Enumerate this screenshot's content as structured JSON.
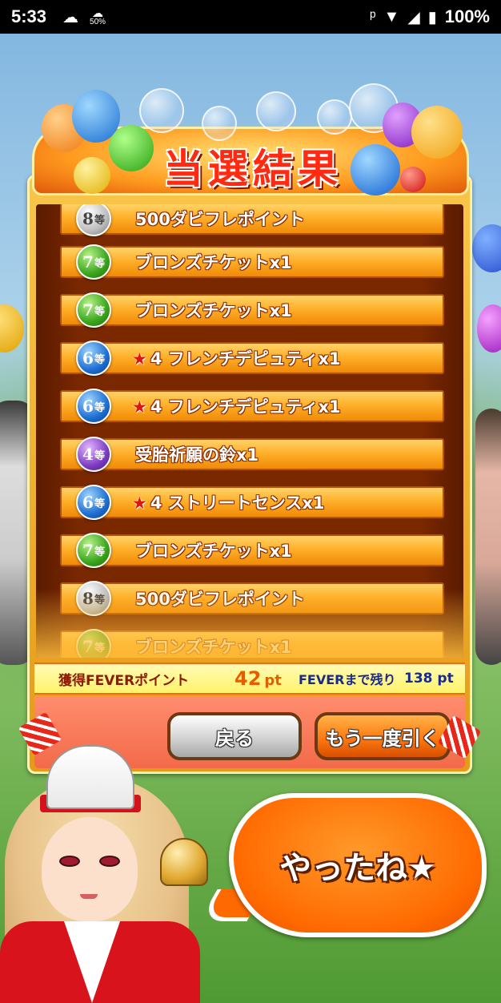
{
  "status_bar": {
    "time": "5:33",
    "weather_icon": "partly-cloudy-icon",
    "data_saver_pct": "50%",
    "battery": "100%"
  },
  "title": "当選結果",
  "prizes": [
    {
      "rank": "8",
      "suffix": "等",
      "color": "silver",
      "star": "",
      "label": "500ダビフレポイント"
    },
    {
      "rank": "7",
      "suffix": "等",
      "color": "green",
      "star": "",
      "label": "ブロンズチケットx1"
    },
    {
      "rank": "7",
      "suffix": "等",
      "color": "green",
      "star": "",
      "label": "ブロンズチケットx1"
    },
    {
      "rank": "6",
      "suffix": "等",
      "color": "blue",
      "star": "★",
      "label": "4 フレンチデピュティx1"
    },
    {
      "rank": "6",
      "suffix": "等",
      "color": "blue",
      "star": "★",
      "label": "4 フレンチデピュティx1"
    },
    {
      "rank": "4",
      "suffix": "等",
      "color": "purple",
      "star": "",
      "label": "受胎祈願の鈴x1"
    },
    {
      "rank": "6",
      "suffix": "等",
      "color": "blue",
      "star": "★",
      "label": "4 ストリートセンスx1"
    },
    {
      "rank": "7",
      "suffix": "等",
      "color": "green",
      "star": "",
      "label": "ブロンズチケットx1"
    },
    {
      "rank": "8",
      "suffix": "等",
      "color": "silver",
      "star": "",
      "label": "500ダビフレポイント"
    },
    {
      "rank": "7",
      "suffix": "等",
      "color": "green",
      "star": "",
      "label": "ブロンズチケットx1"
    }
  ],
  "points": {
    "label": "獲得FEVERポイント",
    "value": "42",
    "unit": "pt",
    "fever_label": "FEVERまで残り",
    "fever_value": "138 pt"
  },
  "buttons": {
    "back": "戻る",
    "again": "もう一度引く"
  },
  "speech": "やったね★"
}
